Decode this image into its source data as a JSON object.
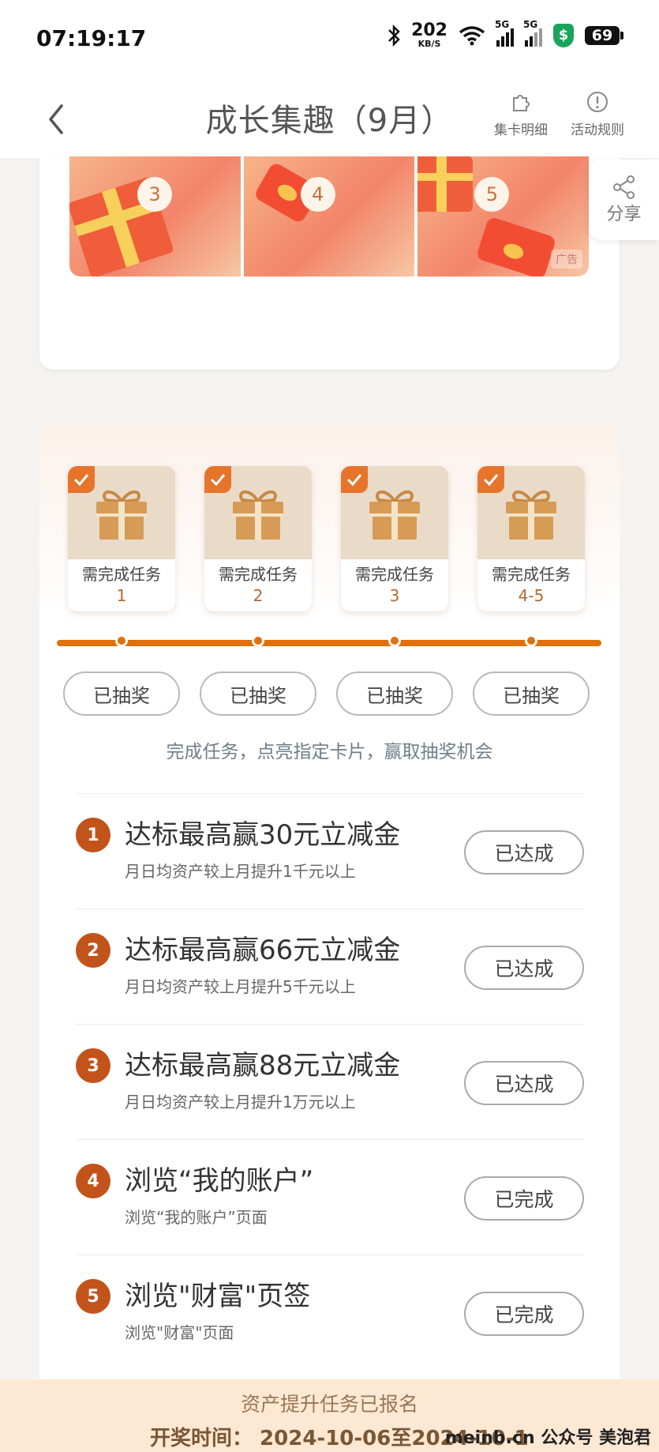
{
  "status_bar": {
    "time": "07:19:17",
    "net_speed": "202",
    "net_unit": "KB/S",
    "sim1": "5G",
    "sim2": "5G",
    "battery": "69"
  },
  "nav": {
    "title": "成长集趣（9月）",
    "card_detail": "集卡明细",
    "rules": "活动规则"
  },
  "banners": [
    {
      "number": "3"
    },
    {
      "number": "4"
    },
    {
      "number": "5",
      "ad": "广告"
    }
  ],
  "share": {
    "label": "分享"
  },
  "stages": [
    {
      "label": "需完成任务",
      "tasks": "1"
    },
    {
      "label": "需完成任务",
      "tasks": "2"
    },
    {
      "label": "需完成任务",
      "tasks": "3"
    },
    {
      "label": "需完成任务",
      "tasks": "4-5"
    }
  ],
  "draw_buttons": [
    "已抽奖",
    "已抽奖",
    "已抽奖",
    "已抽奖"
  ],
  "hint": "完成任务，点亮指定卡片，赢取抽奖机会",
  "tasks": [
    {
      "index": "1",
      "title": "达标最高赢30元立减金",
      "subtitle": "月日均资产较上月提升1千元以上",
      "status": "已达成"
    },
    {
      "index": "2",
      "title": "达标最高赢66元立减金",
      "subtitle": "月日均资产较上月提升5千元以上",
      "status": "已达成"
    },
    {
      "index": "3",
      "title": "达标最高赢88元立减金",
      "subtitle": "月日均资产较上月提升1万元以上",
      "status": "已达成"
    },
    {
      "index": "4",
      "title": "浏览“我的账户”",
      "subtitle": "浏览“我的账户”页面",
      "status": "已完成"
    },
    {
      "index": "5",
      "title": "浏览\"财富\"页签",
      "subtitle": "浏览\"财富\"页面",
      "status": "已完成"
    }
  ],
  "footer": {
    "registered": "资产提升任务已报名",
    "draw_time": "开奖时间： 2024-10-06至2024-10-1",
    "watermark": "meinb.cn 公众号 美泡君"
  },
  "colors": {
    "accent": "#e0700c",
    "badge": "#c2531a",
    "stage_top": "#eadbc8",
    "footer_bg": "#fde8d3"
  }
}
